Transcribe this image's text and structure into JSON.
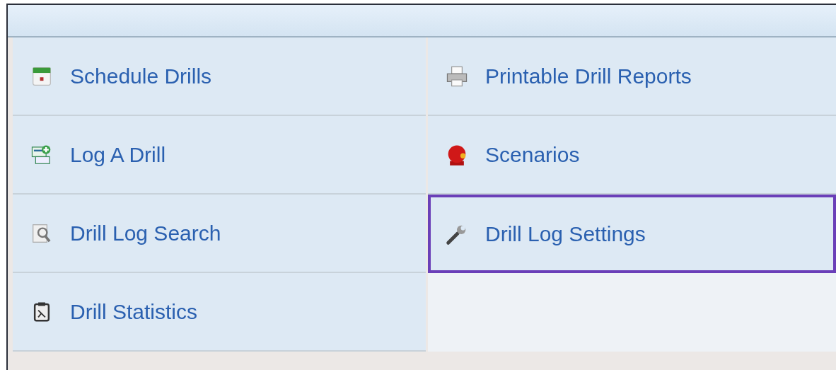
{
  "columns": [
    {
      "items": [
        {
          "label": "Schedule Drills",
          "selected": false
        },
        {
          "label": "Log A Drill",
          "selected": false
        },
        {
          "label": "Drill Log Search",
          "selected": false
        },
        {
          "label": "Drill Statistics",
          "selected": false
        }
      ]
    },
    {
      "items": [
        {
          "label": "Printable Drill Reports",
          "selected": false
        },
        {
          "label": "Scenarios",
          "selected": false
        },
        {
          "label": "Drill Log Settings",
          "selected": true
        }
      ]
    }
  ]
}
